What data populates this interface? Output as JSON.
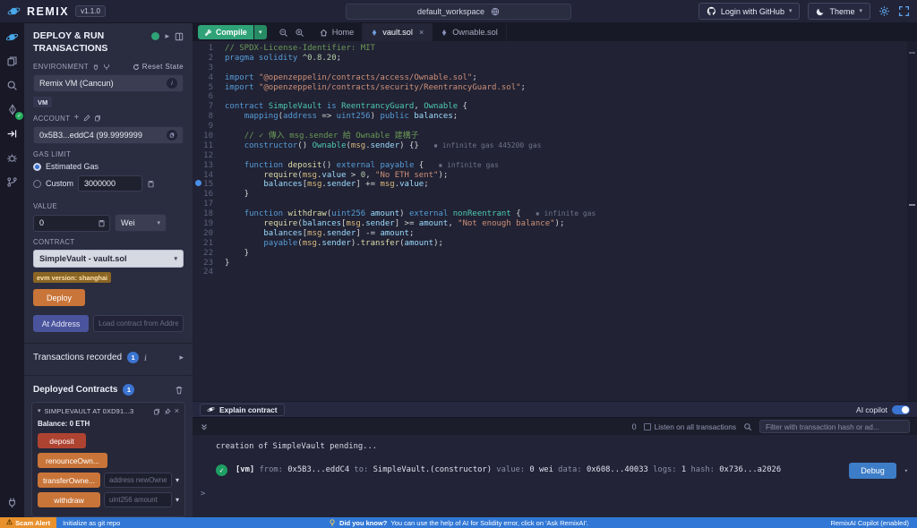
{
  "topbar": {
    "brand": "REMIX",
    "version": "v1.1.0",
    "workspace": "default_workspace",
    "login_github": "Login with GitHub",
    "theme": "Theme"
  },
  "panel": {
    "title": "DEPLOY & RUN TRANSACTIONS",
    "environment_label": "ENVIRONMENT",
    "reset_state": "Reset State",
    "environment_value": "Remix VM (Cancun)",
    "vm_badge": "VM",
    "account_label": "ACCOUNT",
    "account_value": "0x5B3...eddC4 (99.9999999",
    "gas_label": "GAS LIMIT",
    "gas_estimated": "Estimated Gas",
    "gas_custom": "Custom",
    "gas_custom_value": "3000000",
    "value_label": "VALUE",
    "value_amount": "0",
    "value_unit": "Wei",
    "contract_label": "CONTRACT",
    "contract_value": "SimpleVault - vault.sol",
    "evm_badge": "evm version: shanghai",
    "deploy_label": "Deploy",
    "at_address_label": "At Address",
    "at_address_placeholder": "Load contract from Address",
    "transactions_label": "Transactions recorded",
    "transactions_count": "1",
    "transactions_info": "i",
    "deployed_label": "Deployed Contracts",
    "deployed_count": "1",
    "contract_item": {
      "title": "SIMPLEVAULT AT 0XD91...3",
      "balance_label": "Balance:",
      "balance_value": "0 ETH"
    },
    "functions": [
      {
        "label": "deposit"
      },
      {
        "label": "renounceOwn..."
      },
      {
        "label": "transferOwne...",
        "placeholder": "address newOwner"
      },
      {
        "label": "withdraw",
        "placeholder": "uint256 amount"
      }
    ]
  },
  "editor": {
    "compile_label": "Compile",
    "tabs": [
      {
        "label": "Home"
      },
      {
        "label": "vault.sol"
      },
      {
        "label": "Ownable.sol"
      }
    ],
    "lines": [
      [
        [
          "cm",
          "// SPDX-License-Identifier: MIT"
        ]
      ],
      [
        [
          "kw",
          "pragma solidity"
        ],
        [
          "pl",
          " "
        ],
        [
          "nm",
          "^0.8.20"
        ],
        [
          "pl",
          ";"
        ]
      ],
      [],
      [
        [
          "kw",
          "import"
        ],
        [
          "pl",
          " "
        ],
        [
          "st",
          "\"@openzeppelin/contracts/access/Ownable.sol\""
        ],
        [
          "pl",
          ";"
        ]
      ],
      [
        [
          "kw",
          "import"
        ],
        [
          "pl",
          " "
        ],
        [
          "st",
          "\"@openzeppelin/contracts/security/ReentrancyGuard.sol\""
        ],
        [
          "pl",
          ";"
        ]
      ],
      [],
      [
        [
          "kw",
          "contract"
        ],
        [
          "pl",
          " "
        ],
        [
          "ty",
          "SimpleVault"
        ],
        [
          "pl",
          " "
        ],
        [
          "kw",
          "is"
        ],
        [
          "pl",
          " "
        ],
        [
          "ty",
          "ReentrancyGuard"
        ],
        [
          "pl",
          ", "
        ],
        [
          "ty",
          "Ownable"
        ],
        [
          "pl",
          " {"
        ]
      ],
      [
        [
          "pl",
          "    "
        ],
        [
          "kw",
          "mapping"
        ],
        [
          "pl",
          "("
        ],
        [
          "kw",
          "address"
        ],
        [
          "pl",
          " => "
        ],
        [
          "kw",
          "uint256"
        ],
        [
          "pl",
          ") "
        ],
        [
          "kw",
          "public"
        ],
        [
          "pl",
          " "
        ],
        [
          "vr",
          "balances"
        ],
        [
          "pl",
          ";"
        ]
      ],
      [],
      [
        [
          "pl",
          "    "
        ],
        [
          "cm",
          "// ✓ 傳入 msg.sender 給 Ownable 建構子"
        ]
      ],
      [
        [
          "pl",
          "    "
        ],
        [
          "kw",
          "constructor"
        ],
        [
          "pl",
          "() "
        ],
        [
          "ty",
          "Ownable"
        ],
        [
          "pl",
          "("
        ],
        [
          "sp",
          "msg"
        ],
        [
          "pl",
          "."
        ],
        [
          "vr",
          "sender"
        ],
        [
          "pl",
          ") {}   "
        ],
        [
          "gs",
          "▪ infinite gas 445200 gas"
        ]
      ],
      [],
      [
        [
          "pl",
          "    "
        ],
        [
          "kw",
          "function"
        ],
        [
          "pl",
          " "
        ],
        [
          "fn",
          "deposit"
        ],
        [
          "pl",
          "() "
        ],
        [
          "kw",
          "external"
        ],
        [
          "pl",
          " "
        ],
        [
          "kw",
          "payable"
        ],
        [
          "pl",
          " {   "
        ],
        [
          "gs",
          "▪ infinite gas"
        ]
      ],
      [
        [
          "pl",
          "        "
        ],
        [
          "fn",
          "require"
        ],
        [
          "pl",
          "("
        ],
        [
          "sp",
          "msg"
        ],
        [
          "pl",
          "."
        ],
        [
          "vr",
          "value"
        ],
        [
          "pl",
          " > "
        ],
        [
          "nm",
          "0"
        ],
        [
          "pl",
          ", "
        ],
        [
          "st",
          "\"No ETH sent\""
        ],
        [
          "pl",
          ");"
        ]
      ],
      [
        [
          "pl",
          "        "
        ],
        [
          "vr",
          "balances"
        ],
        [
          "pl",
          "["
        ],
        [
          "sp",
          "msg"
        ],
        [
          "pl",
          "."
        ],
        [
          "vr",
          "sender"
        ],
        [
          "pl",
          "] += "
        ],
        [
          "sp",
          "msg"
        ],
        [
          "pl",
          "."
        ],
        [
          "vr",
          "value"
        ],
        [
          "pl",
          ";"
        ]
      ],
      [
        [
          "pl",
          "    }"
        ]
      ],
      [],
      [
        [
          "pl",
          "    "
        ],
        [
          "kw",
          "function"
        ],
        [
          "pl",
          " "
        ],
        [
          "fn",
          "withdraw"
        ],
        [
          "pl",
          "("
        ],
        [
          "kw",
          "uint256"
        ],
        [
          "pl",
          " "
        ],
        [
          "vr",
          "amount"
        ],
        [
          "pl",
          ") "
        ],
        [
          "kw",
          "external"
        ],
        [
          "pl",
          " "
        ],
        [
          "ty",
          "nonReentrant"
        ],
        [
          "pl",
          " {   "
        ],
        [
          "gs",
          "▪ infinite gas"
        ]
      ],
      [
        [
          "pl",
          "        "
        ],
        [
          "fn",
          "require"
        ],
        [
          "pl",
          "("
        ],
        [
          "vr",
          "balances"
        ],
        [
          "pl",
          "["
        ],
        [
          "sp",
          "msg"
        ],
        [
          "pl",
          "."
        ],
        [
          "vr",
          "sender"
        ],
        [
          "pl",
          "] >= "
        ],
        [
          "vr",
          "amount"
        ],
        [
          "pl",
          ", "
        ],
        [
          "st",
          "\"Not enough balance\""
        ],
        [
          "pl",
          ");"
        ]
      ],
      [
        [
          "pl",
          "        "
        ],
        [
          "vr",
          "balances"
        ],
        [
          "pl",
          "["
        ],
        [
          "sp",
          "msg"
        ],
        [
          "pl",
          "."
        ],
        [
          "vr",
          "sender"
        ],
        [
          "pl",
          "] -= "
        ],
        [
          "vr",
          "amount"
        ],
        [
          "pl",
          ";"
        ]
      ],
      [
        [
          "pl",
          "        "
        ],
        [
          "kw",
          "payable"
        ],
        [
          "pl",
          "("
        ],
        [
          "sp",
          "msg"
        ],
        [
          "pl",
          "."
        ],
        [
          "vr",
          "sender"
        ],
        [
          "pl",
          ")."
        ],
        [
          "fn",
          "transfer"
        ],
        [
          "pl",
          "("
        ],
        [
          "vr",
          "amount"
        ],
        [
          "pl",
          ");"
        ]
      ],
      [
        [
          "pl",
          "    }"
        ]
      ],
      [
        [
          "pl",
          "}"
        ]
      ],
      []
    ]
  },
  "ai": {
    "explain_label": "Explain contract",
    "copilot_label": "AI copilot"
  },
  "terminal": {
    "count": "0",
    "listen_label": "Listen on all transactions",
    "filter_placeholder": "Filter with transaction hash or ad...",
    "pending_line": "creation of SimpleVault pending...",
    "tx_tag": "[vm]",
    "tx_fields": [
      {
        "k": "from:",
        "v": "0x5B3...eddC4"
      },
      {
        "k": "to:",
        "v": "SimpleVault.(constructor)"
      },
      {
        "k": "value:",
        "v": "0 wei"
      },
      {
        "k": "data:",
        "v": "0x608...40033"
      },
      {
        "k": "logs:",
        "v": "1"
      },
      {
        "k": "hash:",
        "v": "0x736...a2026"
      }
    ],
    "debug_label": "Debug",
    "prompt": ">"
  },
  "statusbar": {
    "scam_alert": "Scam Alert",
    "git_init": "Initialize as git repo",
    "tip_bold": "Did you know?",
    "tip_text": "You can use the help of AI for Solidity error, click on 'Ask RemixAI'.",
    "copilot_status": "RemixAI Copilot (enabled)"
  },
  "colors": {
    "accent_blue": "#3b74d1",
    "success_green": "#2fa377",
    "warning_orange": "#c97539",
    "danger_red": "#ae4331",
    "statusbar_blue": "#3178d6",
    "scam_orange": "#e8912d"
  }
}
